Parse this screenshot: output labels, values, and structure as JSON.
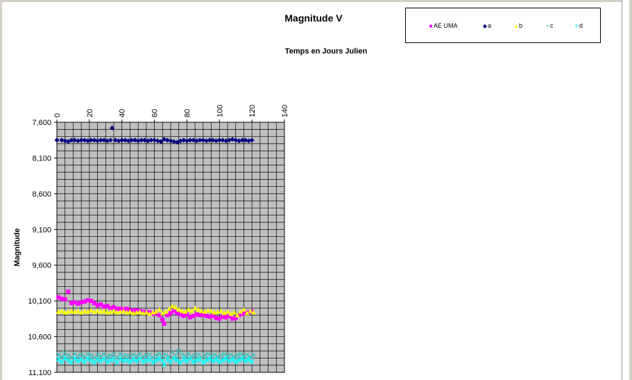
{
  "chart_data": {
    "type": "scatter",
    "title": "Magnitude V",
    "xlabel": "Temps en Jours Julien",
    "ylabel": "Magnitude",
    "xlim": [
      0,
      140
    ],
    "ylim": [
      7.6,
      11.1
    ],
    "y_reversed": true,
    "x_axis_position": "top",
    "x_ticks": [
      "0",
      "20",
      "40",
      "60",
      "80",
      "100",
      "120",
      "140"
    ],
    "y_ticks": [
      "7,600",
      "8,100",
      "8,600",
      "9,100",
      "9,600",
      "10,100",
      "10,600",
      "11,100"
    ],
    "grid": true,
    "plot_background": "#c0c0c0",
    "legend_position": "top-right",
    "series": [
      {
        "name": "AE UMA",
        "marker": "square",
        "color": "#ff00ff",
        "points": [
          [
            1,
            10.05
          ],
          [
            3,
            10.07
          ],
          [
            5,
            10.08
          ],
          [
            7,
            9.97
          ],
          [
            9,
            10.13
          ],
          [
            11,
            10.12
          ],
          [
            13,
            10.14
          ],
          [
            15,
            10.12
          ],
          [
            17,
            10.11
          ],
          [
            19,
            10.09
          ],
          [
            21,
            10.1
          ],
          [
            23,
            10.13
          ],
          [
            25,
            10.16
          ],
          [
            27,
            10.15
          ],
          [
            29,
            10.18
          ],
          [
            31,
            10.17
          ],
          [
            33,
            10.2
          ],
          [
            35,
            10.19
          ],
          [
            37,
            10.21
          ],
          [
            39,
            10.21
          ],
          [
            41,
            10.22
          ],
          [
            43,
            10.21
          ],
          [
            45,
            10.23
          ],
          [
            47,
            10.24
          ],
          [
            49,
            10.23
          ],
          [
            51,
            10.24
          ],
          [
            53,
            10.25
          ],
          [
            55,
            10.26
          ],
          [
            57,
            10.26
          ],
          [
            59,
            10.28
          ],
          [
            61,
            10.27
          ],
          [
            63,
            10.3
          ],
          [
            65,
            10.36
          ],
          [
            66,
            10.42
          ],
          [
            68,
            10.3
          ],
          [
            70,
            10.27
          ],
          [
            72,
            10.24
          ],
          [
            74,
            10.27
          ],
          [
            76,
            10.29
          ],
          [
            78,
            10.31
          ],
          [
            80,
            10.29
          ],
          [
            82,
            10.33
          ],
          [
            84,
            10.31
          ],
          [
            86,
            10.29
          ],
          [
            88,
            10.3
          ],
          [
            90,
            10.29
          ],
          [
            92,
            10.31
          ],
          [
            94,
            10.32
          ],
          [
            96,
            10.31
          ],
          [
            98,
            10.34
          ],
          [
            100,
            10.35
          ],
          [
            102,
            10.32
          ],
          [
            104,
            10.33
          ],
          [
            106,
            10.31
          ],
          [
            108,
            10.35
          ],
          [
            110,
            10.34
          ],
          [
            112,
            10.3
          ],
          [
            114,
            10.28
          ],
          [
            116,
            10.27
          ],
          [
            118,
            10.26
          ],
          [
            120,
            10.25
          ]
        ]
      },
      {
        "name": "a",
        "marker": "diamond",
        "color": "#000080",
        "points": [
          [
            0,
            7.85
          ],
          [
            3,
            7.85
          ],
          [
            5,
            7.86
          ],
          [
            7,
            7.87
          ],
          [
            9,
            7.85
          ],
          [
            11,
            7.85
          ],
          [
            13,
            7.86
          ],
          [
            15,
            7.85
          ],
          [
            17,
            7.85
          ],
          [
            19,
            7.86
          ],
          [
            21,
            7.85
          ],
          [
            23,
            7.85
          ],
          [
            25,
            7.86
          ],
          [
            27,
            7.85
          ],
          [
            29,
            7.85
          ],
          [
            31,
            7.86
          ],
          [
            33,
            7.85
          ],
          [
            34,
            7.68
          ],
          [
            36,
            7.85
          ],
          [
            38,
            7.86
          ],
          [
            40,
            7.85
          ],
          [
            42,
            7.85
          ],
          [
            44,
            7.86
          ],
          [
            46,
            7.85
          ],
          [
            48,
            7.85
          ],
          [
            50,
            7.86
          ],
          [
            52,
            7.85
          ],
          [
            54,
            7.85
          ],
          [
            56,
            7.86
          ],
          [
            58,
            7.85
          ],
          [
            60,
            7.85
          ],
          [
            62,
            7.86
          ],
          [
            64,
            7.87
          ],
          [
            66,
            7.84
          ],
          [
            68,
            7.85
          ],
          [
            70,
            7.86
          ],
          [
            72,
            7.87
          ],
          [
            74,
            7.88
          ],
          [
            76,
            7.86
          ],
          [
            78,
            7.85
          ],
          [
            80,
            7.86
          ],
          [
            82,
            7.85
          ],
          [
            84,
            7.85
          ],
          [
            86,
            7.86
          ],
          [
            88,
            7.85
          ],
          [
            90,
            7.85
          ],
          [
            92,
            7.86
          ],
          [
            94,
            7.85
          ],
          [
            96,
            7.85
          ],
          [
            98,
            7.86
          ],
          [
            100,
            7.85
          ],
          [
            102,
            7.85
          ],
          [
            104,
            7.86
          ],
          [
            106,
            7.85
          ],
          [
            108,
            7.84
          ],
          [
            110,
            7.85
          ],
          [
            112,
            7.86
          ],
          [
            114,
            7.85
          ],
          [
            116,
            7.85
          ],
          [
            118,
            7.86
          ],
          [
            120,
            7.85
          ]
        ]
      },
      {
        "name": "b",
        "marker": "triangle",
        "color": "#ffff00",
        "points": [
          [
            1,
            10.25
          ],
          [
            3,
            10.24
          ],
          [
            5,
            10.26
          ],
          [
            7,
            10.25
          ],
          [
            9,
            10.24
          ],
          [
            11,
            10.25
          ],
          [
            13,
            10.24
          ],
          [
            15,
            10.26
          ],
          [
            17,
            10.24
          ],
          [
            19,
            10.25
          ],
          [
            21,
            10.23
          ],
          [
            23,
            10.25
          ],
          [
            25,
            10.24
          ],
          [
            27,
            10.25
          ],
          [
            29,
            10.24
          ],
          [
            31,
            10.26
          ],
          [
            33,
            10.25
          ],
          [
            35,
            10.24
          ],
          [
            37,
            10.26
          ],
          [
            39,
            10.25
          ],
          [
            41,
            10.24
          ],
          [
            43,
            10.26
          ],
          [
            45,
            10.25
          ],
          [
            47,
            10.27
          ],
          [
            49,
            10.26
          ],
          [
            51,
            10.25
          ],
          [
            53,
            10.27
          ],
          [
            55,
            10.26
          ],
          [
            57,
            10.28
          ],
          [
            59,
            10.26
          ],
          [
            61,
            10.25
          ],
          [
            63,
            10.22
          ],
          [
            65,
            10.27
          ],
          [
            67,
            10.25
          ],
          [
            69,
            10.21
          ],
          [
            71,
            10.17
          ],
          [
            73,
            10.19
          ],
          [
            75,
            10.22
          ],
          [
            77,
            10.24
          ],
          [
            79,
            10.25
          ],
          [
            81,
            10.22
          ],
          [
            83,
            10.24
          ],
          [
            85,
            10.2
          ],
          [
            87,
            10.22
          ],
          [
            89,
            10.24
          ],
          [
            91,
            10.25
          ],
          [
            93,
            10.23
          ],
          [
            95,
            10.24
          ],
          [
            97,
            10.26
          ],
          [
            99,
            10.25
          ],
          [
            101,
            10.24
          ],
          [
            103,
            10.27
          ],
          [
            105,
            10.25
          ],
          [
            107,
            10.28
          ],
          [
            109,
            10.26
          ],
          [
            111,
            10.3
          ],
          [
            113,
            10.25
          ],
          [
            115,
            10.22
          ],
          [
            117,
            10.27
          ],
          [
            119,
            10.24
          ],
          [
            121,
            10.26
          ]
        ]
      },
      {
        "name": "c",
        "marker": "x",
        "color": "#40c0c0",
        "points": [
          [
            1,
            10.85
          ],
          [
            3,
            10.88
          ],
          [
            5,
            10.82
          ],
          [
            7,
            10.86
          ],
          [
            9,
            10.89
          ],
          [
            11,
            10.84
          ],
          [
            13,
            10.87
          ],
          [
            15,
            10.85
          ],
          [
            17,
            10.88
          ],
          [
            19,
            10.84
          ],
          [
            21,
            10.86
          ],
          [
            23,
            10.89
          ],
          [
            25,
            10.85
          ],
          [
            27,
            10.87
          ],
          [
            29,
            10.84
          ],
          [
            31,
            10.88
          ],
          [
            33,
            10.86
          ],
          [
            35,
            10.85
          ],
          [
            37,
            10.89
          ],
          [
            39,
            10.84
          ],
          [
            41,
            10.87
          ],
          [
            43,
            10.86
          ],
          [
            45,
            10.88
          ],
          [
            47,
            10.85
          ],
          [
            49,
            10.87
          ],
          [
            51,
            10.84
          ],
          [
            53,
            10.88
          ],
          [
            55,
            10.86
          ],
          [
            57,
            10.85
          ],
          [
            59,
            10.89
          ],
          [
            61,
            10.86
          ],
          [
            63,
            10.84
          ],
          [
            65,
            10.87
          ],
          [
            67,
            10.85
          ],
          [
            69,
            10.88
          ],
          [
            71,
            10.82
          ],
          [
            73,
            10.86
          ],
          [
            75,
            10.8
          ],
          [
            77,
            10.85
          ],
          [
            79,
            10.87
          ],
          [
            81,
            10.84
          ],
          [
            83,
            10.88
          ],
          [
            85,
            10.86
          ],
          [
            87,
            10.85
          ],
          [
            89,
            10.89
          ],
          [
            91,
            10.86
          ],
          [
            93,
            10.84
          ],
          [
            95,
            10.87
          ],
          [
            97,
            10.85
          ],
          [
            99,
            10.88
          ],
          [
            101,
            10.86
          ],
          [
            103,
            10.84
          ],
          [
            105,
            10.87
          ],
          [
            107,
            10.85
          ],
          [
            109,
            10.88
          ],
          [
            111,
            10.86
          ],
          [
            113,
            10.84
          ],
          [
            115,
            10.87
          ],
          [
            117,
            10.85
          ],
          [
            119,
            10.88
          ],
          [
            121,
            10.86
          ]
        ]
      },
      {
        "name": "d",
        "marker": "asterisk",
        "color": "#00ffff",
        "points": [
          [
            1,
            10.92
          ],
          [
            3,
            10.95
          ],
          [
            5,
            10.9
          ],
          [
            7,
            10.93
          ],
          [
            9,
            10.96
          ],
          [
            11,
            10.91
          ],
          [
            13,
            10.94
          ],
          [
            15,
            10.92
          ],
          [
            17,
            10.95
          ],
          [
            19,
            10.91
          ],
          [
            21,
            10.93
          ],
          [
            23,
            10.96
          ],
          [
            25,
            10.92
          ],
          [
            27,
            10.94
          ],
          [
            29,
            10.91
          ],
          [
            31,
            10.95
          ],
          [
            33,
            10.93
          ],
          [
            35,
            10.92
          ],
          [
            37,
            10.96
          ],
          [
            39,
            10.91
          ],
          [
            41,
            10.94
          ],
          [
            43,
            10.93
          ],
          [
            45,
            10.95
          ],
          [
            47,
            10.92
          ],
          [
            49,
            10.94
          ],
          [
            51,
            10.91
          ],
          [
            53,
            10.95
          ],
          [
            55,
            10.93
          ],
          [
            57,
            10.92
          ],
          [
            59,
            10.96
          ],
          [
            61,
            10.93
          ],
          [
            63,
            10.91
          ],
          [
            65,
            10.94
          ],
          [
            66,
            10.99
          ],
          [
            68,
            10.92
          ],
          [
            70,
            10.95
          ],
          [
            72,
            10.91
          ],
          [
            74,
            10.93
          ],
          [
            76,
            10.96
          ],
          [
            78,
            10.92
          ],
          [
            80,
            10.94
          ],
          [
            82,
            10.91
          ],
          [
            84,
            10.95
          ],
          [
            86,
            10.93
          ],
          [
            88,
            10.92
          ],
          [
            90,
            10.96
          ],
          [
            92,
            10.93
          ],
          [
            94,
            10.91
          ],
          [
            96,
            10.94
          ],
          [
            98,
            10.92
          ],
          [
            100,
            10.95
          ],
          [
            102,
            10.93
          ],
          [
            104,
            10.91
          ],
          [
            106,
            10.94
          ],
          [
            108,
            10.92
          ],
          [
            110,
            10.95
          ],
          [
            112,
            10.93
          ],
          [
            114,
            10.91
          ],
          [
            116,
            10.94
          ],
          [
            118,
            10.92
          ],
          [
            120,
            10.95
          ]
        ]
      }
    ]
  }
}
